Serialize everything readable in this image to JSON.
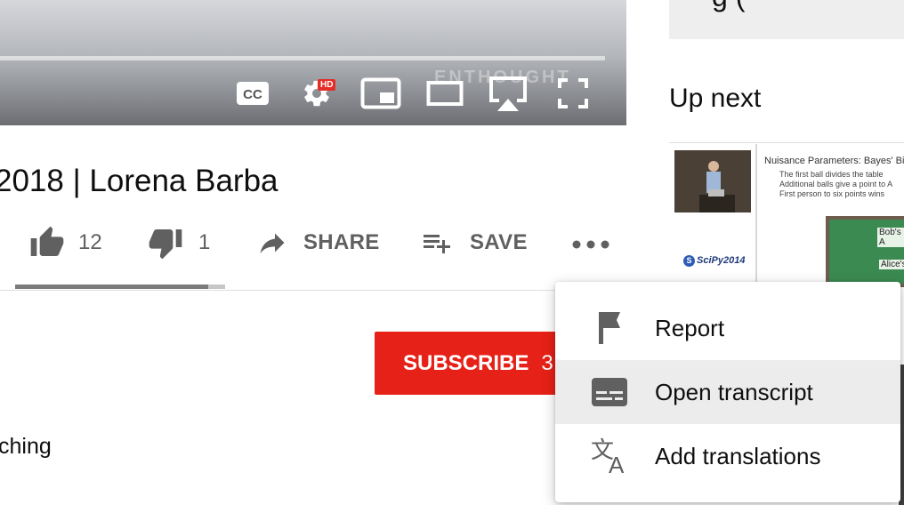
{
  "player": {
    "watermark": "ENTHOUGHT",
    "hd_badge": "HD",
    "controls": [
      "subtitles-cc-icon",
      "settings-gear-icon",
      "miniplayer-icon",
      "theater-mode-icon",
      "airplay-icon",
      "fullscreen-icon"
    ]
  },
  "video": {
    "title": "2018 | Lorena Barba",
    "like_count": "12",
    "dislike_count": "1",
    "share_label": "SHARE",
    "save_label": "SAVE",
    "like_ratio": 0.92
  },
  "channel": {
    "subscribe_label": "SUBSCRIBE",
    "subscribe_count_partial": "3"
  },
  "description": {
    "snippet": "ching"
  },
  "sidebar": {
    "top_text": "g (",
    "up_next_label": "Up next",
    "thumbnail": {
      "heading": "Nuisance Parameters: Bayes' Billia",
      "bullets": [
        "The first ball divides the table",
        "Additional balls give a point to A",
        "First person to six points wins"
      ],
      "bob_label": "Bob's A",
      "alice_label": "Alice's",
      "conference_logo": "SciPy2014"
    }
  },
  "menu": {
    "items": [
      {
        "label": "Report",
        "icon": "flag-icon"
      },
      {
        "label": "Open transcript",
        "icon": "transcript-icon"
      },
      {
        "label": "Add translations",
        "icon": "translate-icon"
      }
    ],
    "highlighted_index": 1
  },
  "colors": {
    "subscribe_red": "#e62117",
    "hd_red": "#e52d27",
    "icon_gray": "#606060",
    "menu_highlight": "#ececec"
  }
}
